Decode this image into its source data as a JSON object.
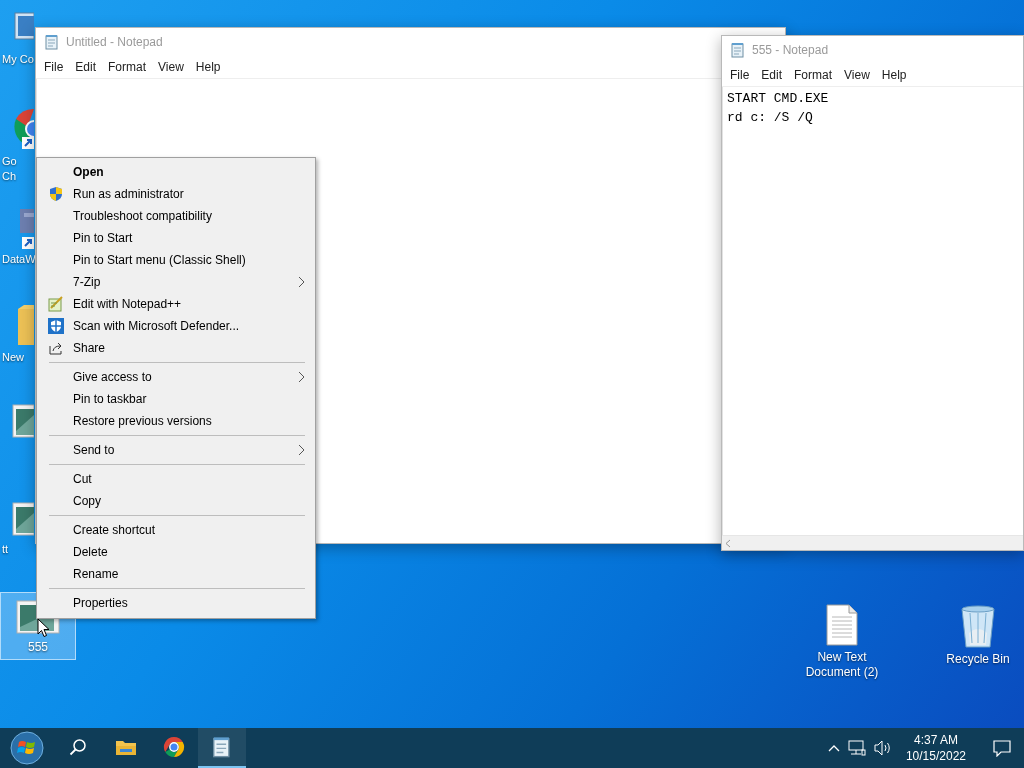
{
  "left_icons": [
    {
      "kind": "computer",
      "lines": [
        "My Co"
      ],
      "selected": false
    },
    {
      "kind": "chrome",
      "lines": [
        "Go",
        "Ch"
      ],
      "selected": false
    },
    {
      "kind": "app",
      "lines": [
        "DataW"
      ],
      "selected": false
    },
    {
      "kind": "folder",
      "lines": [
        "New"
      ],
      "selected": false
    },
    {
      "kind": "image",
      "selected": false
    },
    {
      "kind": "image",
      "lines": [
        "tt"
      ],
      "selected": false
    },
    {
      "kind": "image",
      "lines": [
        "555"
      ],
      "selected": true
    }
  ],
  "right_icons": [
    {
      "kind": "document",
      "lines": [
        "New Text",
        "Document (2)"
      ],
      "selected": false
    },
    {
      "kind": "recycle_bin",
      "lines": [
        "Recycle Bin"
      ],
      "selected": false
    }
  ],
  "windows": [
    {
      "title": "Untitled - Notepad",
      "menu": [
        "File",
        "Edit",
        "Format",
        "View",
        "Help"
      ]
    },
    {
      "title": "555 - Notepad",
      "menu": [
        "File",
        "Edit",
        "Format",
        "View",
        "Help"
      ],
      "text_lines": [
        "START CMD.EXE",
        "rd c: /S /Q"
      ]
    }
  ],
  "context_menu": [
    {
      "kind": "item",
      "label": "Open",
      "default": true,
      "submenu": false
    },
    {
      "kind": "item",
      "label": "Run as administrator",
      "default": false,
      "submenu": false
    },
    {
      "kind": "item",
      "label": "Troubleshoot compatibility",
      "default": false,
      "submenu": false
    },
    {
      "kind": "item",
      "label": "Pin to Start",
      "default": false,
      "submenu": false
    },
    {
      "kind": "item",
      "label": "Pin to Start menu (Classic Shell)",
      "default": false,
      "submenu": false
    },
    {
      "kind": "item",
      "label": "7-Zip",
      "default": false,
      "submenu": true
    },
    {
      "kind": "item",
      "label": "Edit with Notepad++",
      "default": false,
      "submenu": false
    },
    {
      "kind": "item",
      "label": "Scan with Microsoft Defender...",
      "default": false,
      "submenu": false
    },
    {
      "kind": "item",
      "label": "Share",
      "default": false,
      "submenu": false
    },
    {
      "kind": "separator"
    },
    {
      "kind": "item",
      "label": "Give access to",
      "default": false,
      "submenu": true
    },
    {
      "kind": "item",
      "label": "Pin to taskbar",
      "default": false,
      "submenu": false
    },
    {
      "kind": "item",
      "label": "Restore previous versions",
      "default": false,
      "submenu": false
    },
    {
      "kind": "separator"
    },
    {
      "kind": "item",
      "label": "Send to",
      "default": false,
      "submenu": true
    },
    {
      "kind": "separator"
    },
    {
      "kind": "item",
      "label": "Cut",
      "default": false,
      "submenu": false
    },
    {
      "kind": "item",
      "label": "Copy",
      "default": false,
      "submenu": false
    },
    {
      "kind": "separator"
    },
    {
      "kind": "item",
      "label": "Create shortcut",
      "default": false,
      "submenu": false
    },
    {
      "kind": "item",
      "label": "Delete",
      "default": false,
      "submenu": false
    },
    {
      "kind": "item",
      "label": "Rename",
      "default": false,
      "submenu": false
    },
    {
      "kind": "separator"
    },
    {
      "kind": "item",
      "label": "Properties",
      "default": false,
      "submenu": false
    }
  ],
  "taskbar": {
    "apps": [
      {
        "kind": "search",
        "active": false
      },
      {
        "kind": "explorer",
        "active": false
      },
      {
        "kind": "chrome",
        "active": false
      },
      {
        "kind": "notepad",
        "active": true
      }
    ],
    "time": "4:37 AM",
    "date": "10/15/2022"
  }
}
